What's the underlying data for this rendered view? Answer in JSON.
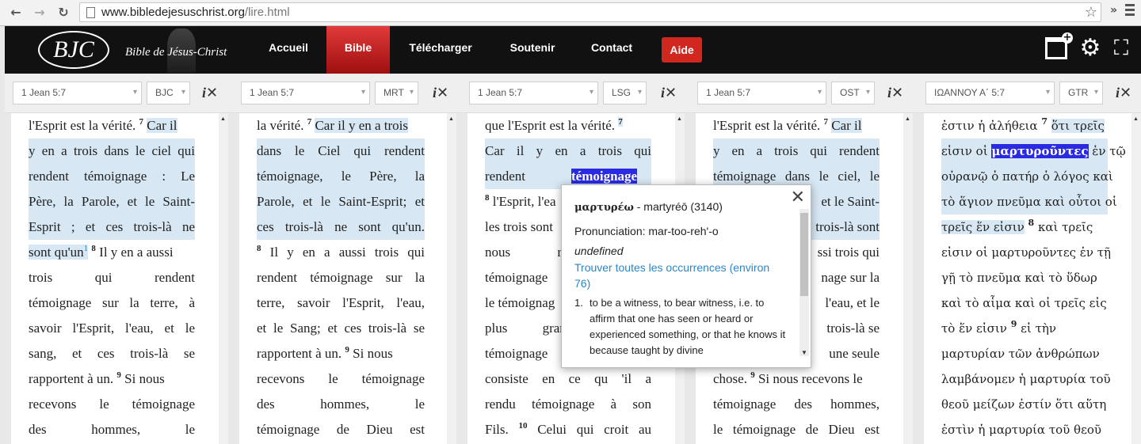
{
  "browser": {
    "url_host": "www.bibledejesuschrist.org",
    "url_path": "/lire.html"
  },
  "header": {
    "logo": "BJC",
    "tagline": "Bible de Jésus-Christ",
    "nav": [
      "Accueil",
      "Bible",
      "Télécharger",
      "Soutenir",
      "Contact"
    ],
    "active": "Bible",
    "help": "Aide"
  },
  "panels": [
    {
      "ref": "1 Jean 5:7",
      "version": "BJC"
    },
    {
      "ref": "1 Jean 5:7",
      "version": "MRT"
    },
    {
      "ref": "1 Jean 5:7",
      "version": "LSG"
    },
    {
      "ref": "1 Jean 5:7",
      "version": "OST"
    },
    {
      "ref": "ΙΩΑΝΝΟΥ Α΄ 5:7",
      "version": "GTR"
    }
  ],
  "ix_label": "i",
  "bjc": {
    "l0": "l'Esprit est la vérité.",
    "v7": "7",
    "l0b": "Car il",
    "l1": "y en a trois dans le ciel qui",
    "l2": "rendent témoignage : Le",
    "l3": "Père, la Parole, et le Saint-",
    "l4": "Esprit ; et ces trois-là ne",
    "l5a": "sont qu'un",
    "fn": "1",
    "v8": "8",
    "l5b": "Il y en a aussi",
    "l6": "trois qui rendent",
    "l7": "témoignage sur la terre, à",
    "l8": "savoir l'Esprit, l'eau, et le",
    "l9": "sang, et ces trois-là se",
    "l10a": "rapportent à un.",
    "v9": "9",
    "l10b": "Si nous",
    "l11": "recevons le témoignage",
    "l12": "des hommes, le"
  },
  "mrt": {
    "l0": "la vérité.",
    "v7": "7",
    "l0b": "Car il y en a trois",
    "l1": "dans le Ciel qui rendent",
    "l2": "témoignage, le Père, la",
    "l3": "Parole, et le Saint-Esprit; et",
    "l4": "ces trois-là ne sont qu'un.",
    "v8": "8",
    "l5": "Il y en a aussi trois qui",
    "l6": "rendent témoignage sur la",
    "l7": "terre, savoir l'Esprit, l'eau,",
    "l8": "et le Sang; et ces trois-là se",
    "l9a": "rapportent à un.",
    "v9": "9",
    "l9b": "Si nous",
    "l10": "recevons le témoignage",
    "l11": "des hommes, le",
    "l12": "témoignage de Dieu est"
  },
  "lsg": {
    "l0": "que l'Esprit est la vérité.",
    "v7": "7",
    "l1": "Car il y en a trois qui",
    "l2a": "rendent",
    "l2b": "témoignage",
    "v8": "8",
    "l3": "l'Esprit, l'ea",
    "l4": "les trois sont",
    "l5": "nous re",
    "l6": "témoignage",
    "l7": "le témoignag",
    "l8": "plus gran",
    "l9": "témoignage",
    "l10": "consiste en ce qu 'il a",
    "l11": "rendu témoignage à son",
    "l12a": "Fils.",
    "v10": "10",
    "l12b": "Celui qui croit au"
  },
  "ost": {
    "l0": "l'Esprit est la vérité.",
    "v7": "7",
    "l0b": "Car il",
    "l1": "y en a trois qui rendent",
    "l2": "témoignage dans le ciel, le",
    "l3": "et le Saint-",
    "l4": "trois-là sont",
    "l5": "ssi trois qui",
    "l6": "nage sur la",
    "l7": "l'eau, et le",
    "l8": "trois-là se",
    "l9": "une seule",
    "l10a": "chose.",
    "v9": "9",
    "l10b": "Si nous recevons le",
    "l11": "témoignage des hommes,",
    "l12": "le témoignage de Dieu est"
  },
  "gtr": {
    "l0": "ἐστιν ἡ ἀλήθεια",
    "v7": "7",
    "l0b": "ὅτι τρεῖς",
    "l1a": "εἰσιν οἱ",
    "l1b": "μαρτυροῦντες",
    "l1c": "ἐν τῷ",
    "l2": "οὐρανῷ ὁ πατήρ ὁ λόγος καὶ",
    "l3": "τὸ ἅγιον πνεῦμα καὶ οὗτοι οἱ",
    "l4": "τρεῖς ἕν εἰσιν",
    "v8": "8",
    "l4b": "καὶ τρεῖς",
    "l5": "εἰσιν οἱ μαρτυροῦντες ἐν τῇ",
    "l6": "γῇ τὸ πνεῦμα καὶ τὸ ὕδωρ",
    "l7": "καὶ τὸ αἷμα καὶ οἱ τρεῖς εἰς",
    "l8a": "τὸ ἕν εἰσιν",
    "v9": "9",
    "l8b": "εἰ τὴν",
    "l9": "μαρτυρίαν τῶν ἀνθρώπων",
    "l10": "λαμβάνομεν ἡ μαρτυρία τοῦ",
    "l11": "θεοῦ μείζων ἐστίν ὅτι αὕτη",
    "l12": "ἐστὶν ἡ μαρτυρία τοῦ θεοῦ"
  },
  "popup": {
    "word": "μαρτυρέω",
    "translit": "- martyréō (3140)",
    "pron": "Pronunciation: mar-too-reh'-o",
    "undef": "undefined",
    "link": "Trouver toutes les occurrences (environ 76)",
    "def_n": "1.",
    "def": "to be a witness, to bear witness, i.e. to affirm that one has seen or heard or experienced something, or that he knows it because taught by divine"
  },
  "colors": {
    "highlight": "#d7e7f3",
    "selected": "#2a2ae0",
    "accent": "#d0281f",
    "link": "#2b86c8"
  }
}
